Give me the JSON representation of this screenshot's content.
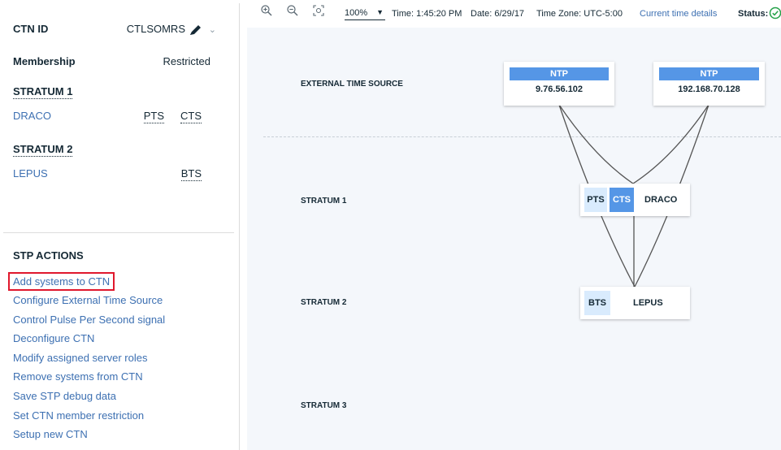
{
  "panel": {
    "ctn_id_label": "CTN ID",
    "ctn_id_value": "CTLSOMRS",
    "membership_label": "Membership",
    "membership_value": "Restricted",
    "stratum1_heading": "STRATUM 1",
    "stratum1_system": "DRACO",
    "stratum1_roles": [
      "PTS",
      "CTS"
    ],
    "stratum2_heading": "STRATUM 2",
    "stratum2_system": "LEPUS",
    "stratum2_roles": [
      "BTS"
    ]
  },
  "actions": {
    "title": "STP ACTIONS",
    "items": [
      "Add systems to CTN",
      "Configure External Time Source",
      "Control Pulse Per Second signal",
      "Deconfigure CTN",
      "Modify assigned server roles",
      "Remove systems from CTN",
      "Save STP debug data",
      "Set CTN member restriction",
      "Setup new CTN"
    ]
  },
  "toolbar": {
    "zoom": "100%",
    "time": "Time: 1:45:20 PM",
    "date": "Date: 6/29/17",
    "timezone": "Time Zone: UTC-5:00",
    "time_details_link": "Current time details",
    "status_label": "Status:"
  },
  "topology": {
    "rows": {
      "external": "EXTERNAL TIME SOURCE",
      "stratum1": "STRATUM 1",
      "stratum2": "STRATUM 2",
      "stratum3": "STRATUM 3"
    },
    "ntp_servers": [
      {
        "label": "NTP",
        "address": "9.76.56.102"
      },
      {
        "label": "NTP",
        "address": "192.168.70.128"
      }
    ],
    "draco": {
      "roles": [
        "PTS",
        "CTS"
      ],
      "name": "DRACO"
    },
    "lepus": {
      "roles": [
        "BTS"
      ],
      "name": "LEPUS"
    }
  },
  "colors": {
    "link": "#3d70b2",
    "ntp_header": "#5596e6",
    "role_light": "#d9ebfd",
    "highlight_border": "#e0182d",
    "status_ok": "#24a148"
  }
}
